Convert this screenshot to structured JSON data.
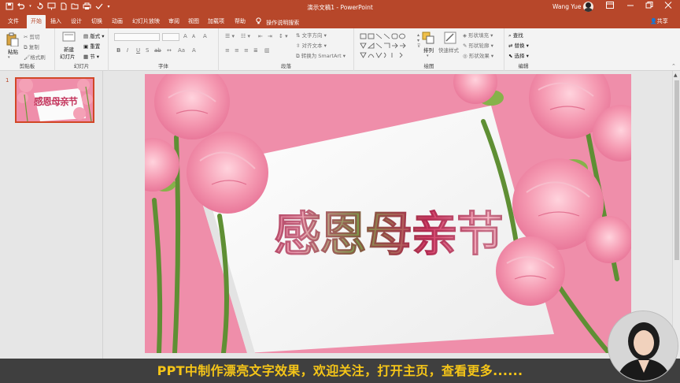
{
  "window": {
    "doc_title": "演示文稿1",
    "separator": " - ",
    "app_name": "PowerPoint",
    "user_name": "Wang Yue"
  },
  "qat_icons": [
    "save-icon",
    "undo-icon",
    "redo-icon",
    "start-slideshow-icon",
    "new-icon",
    "open-icon",
    "print-icon",
    "spell-icon",
    "customize-icon"
  ],
  "tabs": [
    "文件",
    "开始",
    "插入",
    "设计",
    "切换",
    "动画",
    "幻灯片放映",
    "审阅",
    "视图",
    "加载项",
    "帮助"
  ],
  "active_tab": "开始",
  "tell_me": "操作说明搜索",
  "share": "共享",
  "ribbon": {
    "clipboard": {
      "label": "剪贴板",
      "paste": "粘贴",
      "cut": "剪切",
      "copy": "复制",
      "painter": "格式刷"
    },
    "slides": {
      "label": "幻灯片",
      "new_slide": "新建",
      "new_slide2": "幻灯片",
      "layout": "版式",
      "reset": "重置",
      "section": "节"
    },
    "font": {
      "label": "字体",
      "bold": "B",
      "italic": "I",
      "underline": "U",
      "strike": "S",
      "spacing": "ab",
      "case": "Aa",
      "grow": "A",
      "shrink": "A",
      "clear": "A"
    },
    "paragraph": {
      "label": "段落",
      "text_direction": "文字方向",
      "align_text": "对齐文本",
      "smartart": "转换为 SmartArt"
    },
    "drawing": {
      "label": "绘图",
      "arrange": "排列",
      "quick_styles": "快速样式",
      "fill": "形状填充",
      "outline": "形状轮廓",
      "effects": "形状效果"
    },
    "editing": {
      "label": "编辑",
      "find": "查找",
      "replace": "替换",
      "select": "选择"
    }
  },
  "thumbnail": {
    "number": "1",
    "title": "感恩母亲节"
  },
  "slide": {
    "title": "感恩母亲节"
  },
  "caption": "PPT中制作漂亮文字效果，欢迎关注，打开主页，查看更多......",
  "colors": {
    "accent": "#b7472a",
    "caption_text": "#f5c518",
    "caption_bg": "#3f3f3f",
    "slide_bg": "#ef8eaa"
  }
}
